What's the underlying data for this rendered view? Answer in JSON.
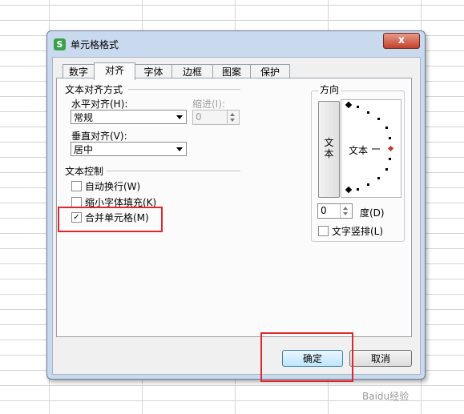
{
  "dialog": {
    "title": "单元格格式",
    "close_label": "x"
  },
  "tabs": [
    "数字",
    "对齐",
    "字体",
    "边框",
    "图案",
    "保护"
  ],
  "alignment": {
    "section_title": "文本对齐方式",
    "horizontal_label": "水平对齐(H):",
    "horizontal_value": "常规",
    "indent_label": "缩进(I):",
    "indent_value": "0",
    "vertical_label": "垂直对齐(V):",
    "vertical_value": "居中"
  },
  "text_control": {
    "section_title": "文本控制",
    "wrap_label": "自动换行(W)",
    "wrap_checked": false,
    "shrink_label": "缩小字体填充(K)",
    "shrink_checked": false,
    "merge_label": "合并单元格(M)",
    "merge_checked": true
  },
  "orientation": {
    "section_title": "方向",
    "vertical_text": "文本",
    "dial_label": "文本",
    "degrees_value": "0",
    "degrees_label": "度(D)",
    "vertical_checkbox_label": "文字竖排(L)",
    "vertical_checked": false
  },
  "buttons": {
    "ok": "确定",
    "cancel": "取消"
  },
  "colors": {
    "highlight": "#e0262c",
    "dial_pointer": "#c0392b"
  },
  "watermark": "Baidu经验"
}
